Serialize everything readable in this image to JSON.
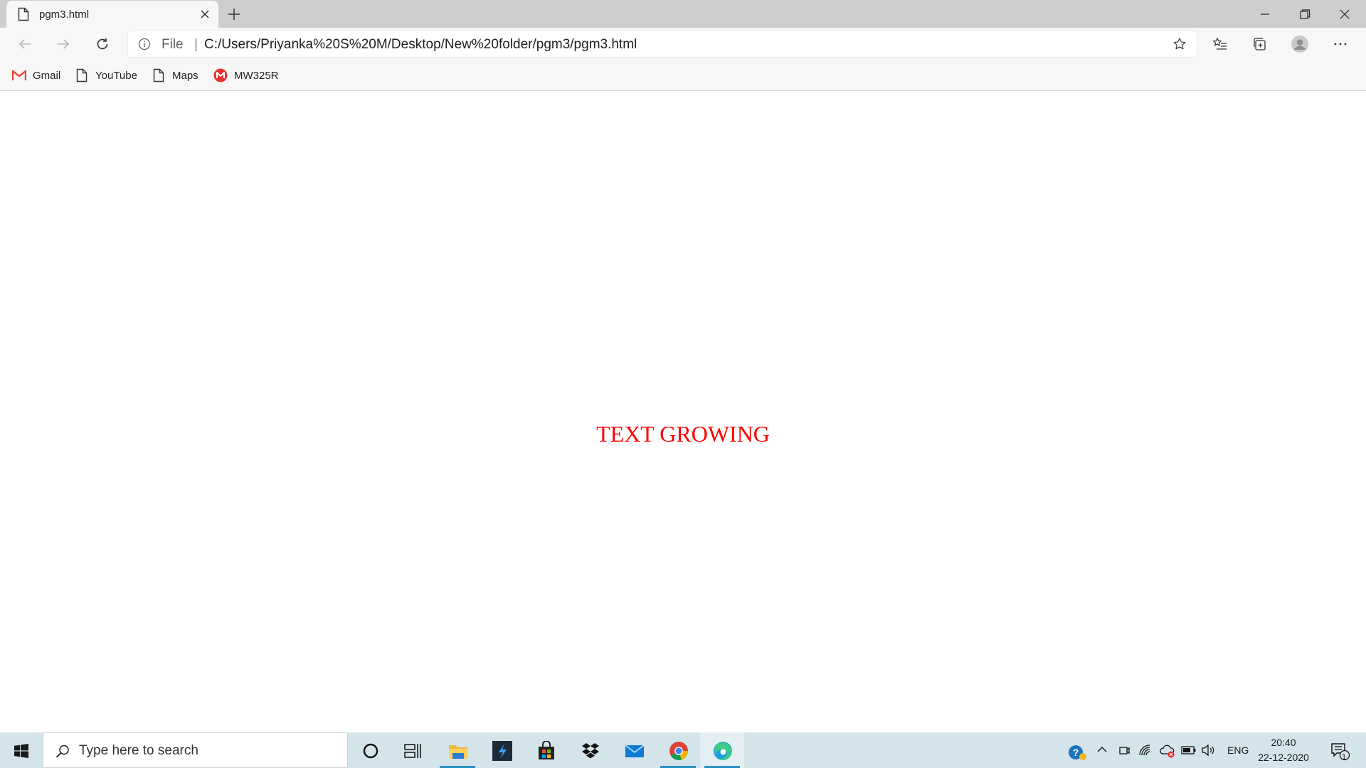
{
  "browser": {
    "tab": {
      "title": "pgm3.html",
      "icon": "document-icon"
    },
    "address": {
      "scheme_label": "File",
      "separator": "|",
      "url": "C:/Users/Priyanka%20S%20M/Desktop/New%20folder/pgm3/pgm3.html"
    },
    "bookmarks": [
      {
        "label": "Gmail",
        "icon": "gmail-icon"
      },
      {
        "label": "YouTube",
        "icon": "page-icon"
      },
      {
        "label": "Maps",
        "icon": "page-icon"
      },
      {
        "label": "MW325R",
        "icon": "mercusys-icon"
      }
    ]
  },
  "page": {
    "text": "TEXT GROWING",
    "text_color": "#ff0000"
  },
  "taskbar": {
    "search_placeholder": "Type here to search",
    "apps": [
      "cortana-icon",
      "task-view-icon",
      "file-explorer-icon",
      "visual-studio-icon",
      "store-icon",
      "dropbox-icon",
      "mail-icon",
      "chrome-icon",
      "edge-icon"
    ],
    "language": "ENG",
    "time": "20:40",
    "date": "22-12-2020",
    "notification_count": "1"
  }
}
